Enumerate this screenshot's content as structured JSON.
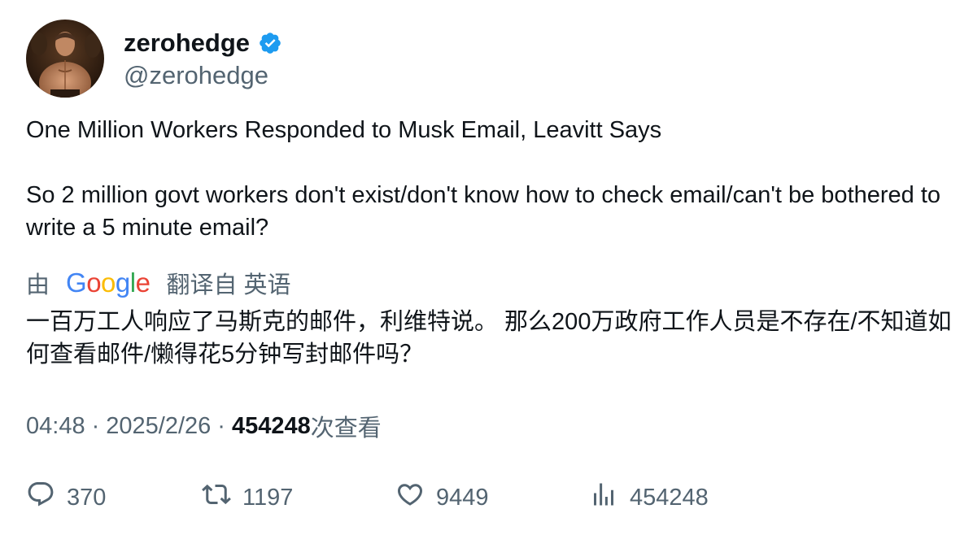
{
  "author": {
    "display_name": "zerohedge",
    "handle": "@zerohedge",
    "verified": true,
    "verified_color": "#1d9bf0"
  },
  "tweet": {
    "line1": "One Million Workers Responded to Musk Email, Leavitt Says",
    "line2": "So 2 million govt workers don't exist/don't know how to check email/can't be bothered to write a 5 minute email?"
  },
  "translation": {
    "by_label": "由",
    "brand": "Google",
    "from_label": "翻译自 英语",
    "text": "一百万工人响应了马斯克的邮件，利维特说。 那么200万政府工作人员是不存在/不知道如何查看邮件/懒得花5分钟写封邮件吗？"
  },
  "meta": {
    "time": "04:48",
    "separator": "·",
    "date": "2025/2/26",
    "views_count": "454248",
    "views_label": "次查看"
  },
  "actions": {
    "replies": "370",
    "retweets": "1197",
    "likes": "9449",
    "views": "454248"
  },
  "icons": {
    "reply": "reply-icon",
    "retweet": "retweet-icon",
    "like": "heart-icon",
    "views": "views-chart-icon",
    "verified": "verified-badge-icon"
  }
}
